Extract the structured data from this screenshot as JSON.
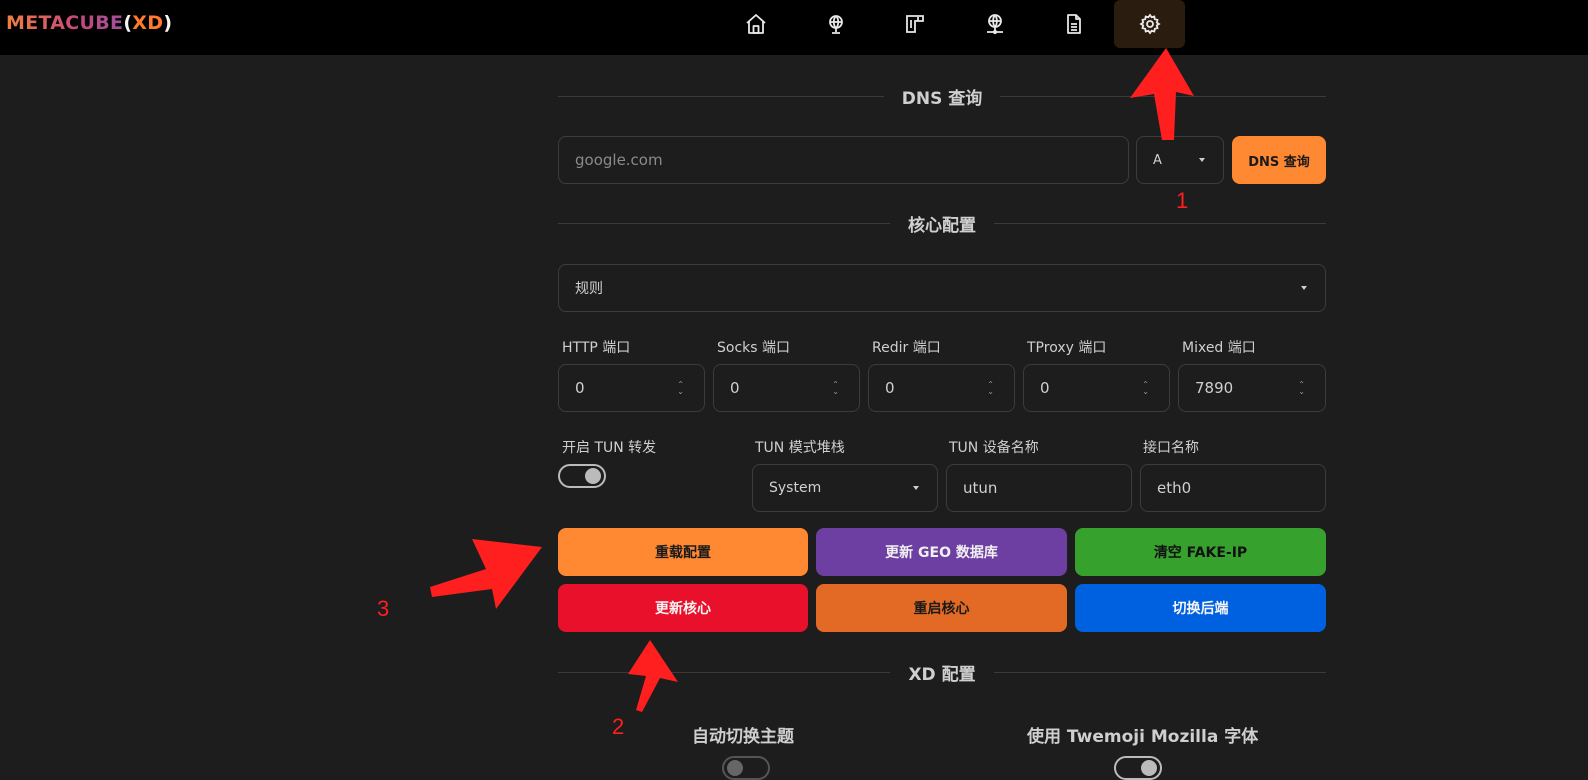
{
  "header": {
    "logo_brand": "METACUBE",
    "logo_open": "(",
    "logo_xd": "XD",
    "logo_close": ")",
    "nav": [
      {
        "icon": "home-icon"
      },
      {
        "icon": "globe-icon"
      },
      {
        "icon": "rules-icon"
      },
      {
        "icon": "network-icon"
      },
      {
        "icon": "document-icon"
      },
      {
        "icon": "gear-icon",
        "active": true
      }
    ]
  },
  "dns": {
    "title": "DNS 查询",
    "input_placeholder": "google.com",
    "record_type": "A",
    "query_button": "DNS 查询"
  },
  "core": {
    "title": "核心配置",
    "mode": "规则",
    "ports": [
      {
        "label": "HTTP 端口",
        "value": "0"
      },
      {
        "label": "Socks 端口",
        "value": "0"
      },
      {
        "label": "Redir 端口",
        "value": "0"
      },
      {
        "label": "TProxy 端口",
        "value": "0"
      },
      {
        "label": "Mixed 端口",
        "value": "7890"
      }
    ],
    "tun_enable_label": "开启 TUN 转发",
    "tun_enabled": true,
    "tun_stack_label": "TUN 模式堆栈",
    "tun_stack": "System",
    "tun_device_label": "TUN 设备名称",
    "tun_device": "utun",
    "interface_label": "接口名称",
    "interface": "eth0",
    "buttons": {
      "reload_config": "重载配置",
      "update_geo": "更新 GEO 数据库",
      "flush_fakeip": "清空 FAKE-IP",
      "update_core": "更新核心",
      "restart_core": "重启核心",
      "switch_backend": "切换后端"
    }
  },
  "xd": {
    "title": "XD 配置",
    "auto_theme_label": "自动切换主题",
    "auto_theme": false,
    "twemoji_label": "使用 Twemoji Mozilla 字体",
    "twemoji": true
  },
  "annotations": {
    "n1": "1",
    "n2": "2",
    "n3": "3"
  },
  "colors": {
    "accent_orange": "#ff8833",
    "purple": "#6e3fa3",
    "green": "#37a12e",
    "red": "#e8102a",
    "dark_orange": "#e26a24",
    "blue": "#0061e0",
    "annotation_red": "#ff1f1f"
  }
}
